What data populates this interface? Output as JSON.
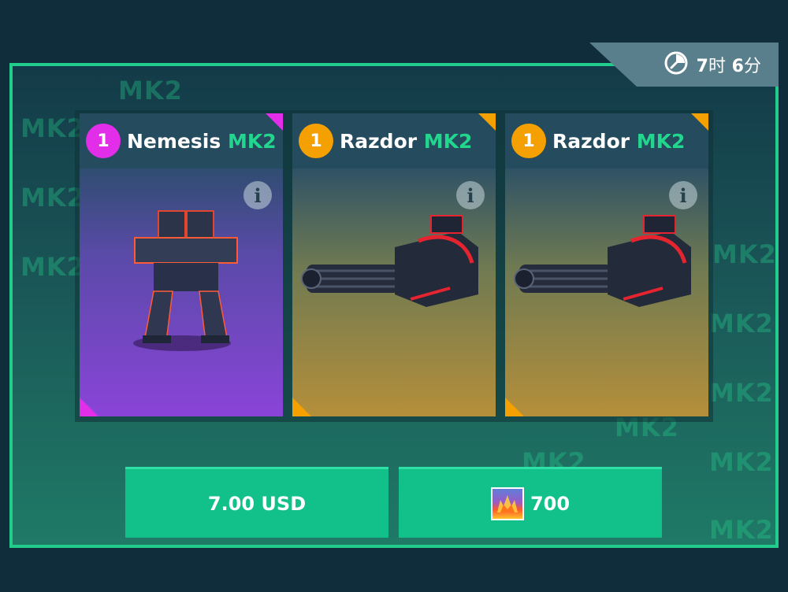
{
  "background_text": "MK2",
  "timer": {
    "hours": "7",
    "hours_unit": "时",
    "minutes": "6",
    "minutes_unit": "分"
  },
  "cards": [
    {
      "quantity": "1",
      "name": "Nemesis",
      "tier": "MK2",
      "rarity": "epic",
      "rarity_color": "#e22ee8",
      "item_type": "robot"
    },
    {
      "quantity": "1",
      "name": "Razdor",
      "tier": "MK2",
      "rarity": "legendary",
      "rarity_color": "#f4a000",
      "item_type": "weapon"
    },
    {
      "quantity": "1",
      "name": "Razdor",
      "tier": "MK2",
      "rarity": "legendary",
      "rarity_color": "#f4a000",
      "item_type": "weapon"
    }
  ],
  "buttons": {
    "usd_label": "7.00 USD",
    "gem_amount": "700",
    "gem_icon": "platinum-icon"
  },
  "colors": {
    "accent_green": "#22cc8c",
    "button_green": "#12c08a",
    "tier_green": "#22d68e"
  }
}
